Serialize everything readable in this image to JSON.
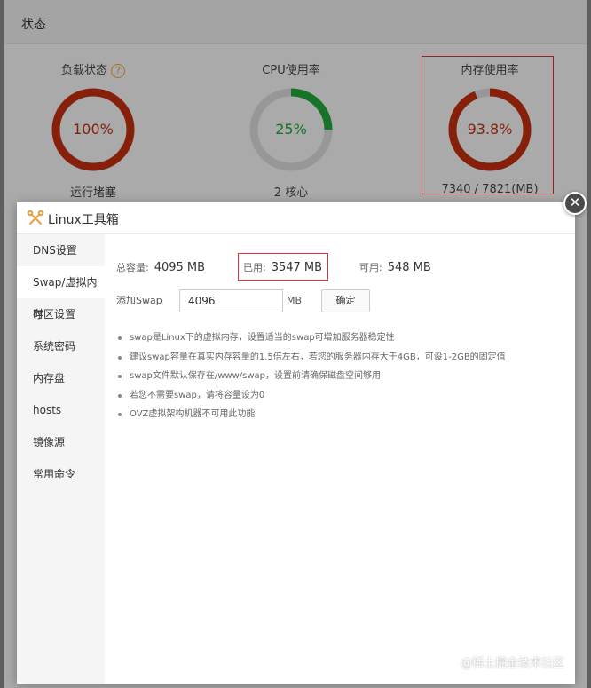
{
  "background": {
    "title": "状态",
    "metrics": [
      {
        "title": "负载状态",
        "value": "100%",
        "subtitle": "运行堵塞",
        "percent": 100,
        "color": "#c02f0f",
        "has_help": true,
        "help_icon": "question-circle-icon",
        "help_char": "?"
      },
      {
        "title": "CPU使用率",
        "value": "25%",
        "subtitle": "2 核心",
        "percent": 25,
        "color": "#20a53a",
        "has_help": false
      },
      {
        "title": "内存使用率",
        "value": "93.8%",
        "subtitle": "7340 / 7821(MB)",
        "percent": 93.8,
        "color": "#c02f0f",
        "has_help": false
      }
    ]
  },
  "modal": {
    "title": "Linux工具箱",
    "icon": "tools-icon",
    "close_icon": "close-icon",
    "close_char": "✕",
    "sidebar": [
      {
        "label": "DNS设置"
      },
      {
        "label": "Swap/虚拟内存",
        "active": true
      },
      {
        "label": "时区设置"
      },
      {
        "label": "系统密码"
      },
      {
        "label": "内存盘"
      },
      {
        "label": "hosts"
      },
      {
        "label": "镜像源"
      },
      {
        "label": "常用命令"
      }
    ],
    "stats": {
      "total_label": "总容量:",
      "total_value": "4095 MB",
      "used_label": "已用:",
      "used_value": "3547 MB",
      "free_label": "可用:",
      "free_value": "548 MB"
    },
    "swap_form": {
      "label": "添加Swap",
      "input_value": "4096",
      "unit": "MB",
      "confirm_label": "确定"
    },
    "tips": [
      "swap是Linux下的虚拟内存，设置适当的swap可增加服务器稳定性",
      "建议swap容量在真实内存容量的1.5倍左右，若您的服务器内存大于4GB，可设1-2GB的固定值",
      "swap文件默认保存在/www/swap，设置前请确保磁盘空间够用",
      "若您不需要swap，请将容量设为0",
      "OVZ虚拟架构机器不可用此功能"
    ]
  },
  "watermark": "@稀土掘金技术社区"
}
